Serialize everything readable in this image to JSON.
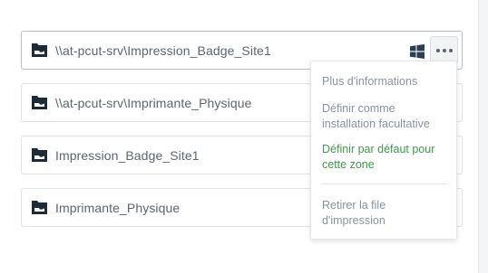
{
  "queues": [
    {
      "name": "\\\\at-pcut-srv\\Impression_Badge_Site1",
      "icon": "folder-tray-icon"
    },
    {
      "name": "\\\\at-pcut-srv\\Imprimante_Physique",
      "icon": "folder-tray-icon"
    },
    {
      "name": "Impression_Badge_Site1",
      "icon": "folder-tray-icon"
    },
    {
      "name": "Imprimante_Physique",
      "icon": "folder-tray-icon"
    }
  ],
  "active_row_icons": [
    "windows-icon",
    "more-icon"
  ],
  "menu": {
    "more_info": "Plus d'informations",
    "optional_install": "Définir comme installation facultative",
    "default_zone": "Définir par défaut pour cette zone",
    "remove_queue": "Retirer la file d'impression"
  },
  "colors": {
    "icon_dark": "#1d2b36",
    "text": "#5d6670",
    "menu_text": "#8a939d",
    "accent_green": "#3e9a4c",
    "windows_blue": "#2c3e50"
  }
}
